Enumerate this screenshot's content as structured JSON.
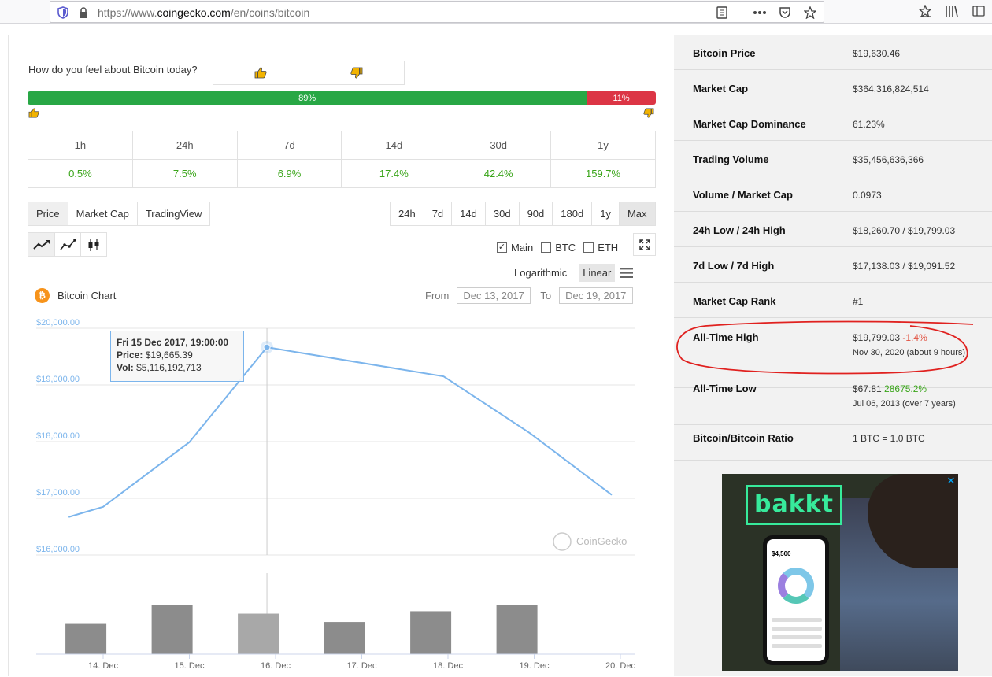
{
  "browser": {
    "url_prefix": "https://www.",
    "url_domain": "coingecko.com",
    "url_path": "/en/coins/bitcoin"
  },
  "sentiment": {
    "question": "How do you feel about Bitcoin today?",
    "bullish_pct": 89,
    "bullish_label": "89%",
    "bearish_label": "11%"
  },
  "changes": {
    "headers": [
      "1h",
      "24h",
      "7d",
      "14d",
      "30d",
      "1y"
    ],
    "values": [
      "0.5%",
      "7.5%",
      "6.9%",
      "17.4%",
      "42.4%",
      "159.7%"
    ]
  },
  "chart_tabs": [
    "Price",
    "Market Cap",
    "TradingView"
  ],
  "range_tabs": [
    "24h",
    "7d",
    "14d",
    "30d",
    "90d",
    "180d",
    "1y",
    "Max"
  ],
  "compare": {
    "main": "Main",
    "btc": "BTC",
    "eth": "ETH"
  },
  "scale": {
    "log": "Logarithmic",
    "linear": "Linear"
  },
  "chart_header": {
    "title": "Bitcoin Chart",
    "from_label": "From",
    "from_value": "Dec 13, 2017",
    "to_label": "To",
    "to_value": "Dec 19, 2017",
    "watermark": "CoinGecko"
  },
  "tooltip": {
    "date": "Fri 15 Dec 2017, 19:00:00",
    "price_label": "Price:",
    "price_value": "$19,665.39",
    "vol_label": "Vol:",
    "vol_value": "$5,116,192,713"
  },
  "chart_data": {
    "type": "line",
    "title": "Bitcoin Chart",
    "ylim": [
      16000,
      20000
    ],
    "y_ticks": [
      "$16,000.00",
      "$17,000.00",
      "$18,000.00",
      "$19,000.00",
      "$20,000.00"
    ],
    "x_ticks": [
      "14. Dec",
      "15. Dec",
      "16. Dec",
      "17. Dec",
      "18. Dec",
      "19. Dec",
      "20. Dec"
    ],
    "x_days": [
      13.6,
      14.0,
      15.0,
      15.9,
      17.95,
      18.95,
      19.9
    ],
    "price": [
      16670,
      16850,
      17990,
      19665,
      19150,
      18150,
      17060
    ],
    "volume_days": [
      13.8,
      14.8,
      15.8,
      16.8,
      17.8,
      18.8
    ],
    "volume_rel": [
      0.62,
      1.0,
      0.83,
      0.66,
      0.88,
      1.0
    ],
    "volume_highlight_index": 2,
    "colors": {
      "line": "#7cb5ec",
      "bar": "#8c8c8c",
      "bar_highlight": "#a8a8a8"
    }
  },
  "stats": [
    {
      "label": "Bitcoin Price",
      "value": "$19,630.46"
    },
    {
      "label": "Market Cap",
      "value": "$364,316,824,514"
    },
    {
      "label": "Market Cap Dominance",
      "value": "61.23%"
    },
    {
      "label": "Trading Volume",
      "value": "$35,456,636,366"
    },
    {
      "label": "Volume / Market Cap",
      "value": "0.0973"
    },
    {
      "label": "24h Low / 24h High",
      "value": "$18,260.70 / $19,799.03"
    },
    {
      "label": "7d Low / 7d High",
      "value": "$17,138.03 / $19,091.52"
    },
    {
      "label": "Market Cap Rank",
      "value": "#1"
    }
  ],
  "ath": {
    "label": "All-Time High",
    "value": "$19,799.03",
    "change": "-1.4%",
    "date": "Nov 30, 2020 (about 9 hours)"
  },
  "atl": {
    "label": "All-Time Low",
    "value": "$67.81",
    "change": "28675.2%",
    "date": "Jul 06, 2013 (over 7 years)"
  },
  "ratio": {
    "label": "Bitcoin/Bitcoin Ratio",
    "value": "1 BTC = 1.0 BTC"
  },
  "ad": {
    "brand": "bakkt",
    "balance": "$4,500",
    "close": "✕"
  }
}
